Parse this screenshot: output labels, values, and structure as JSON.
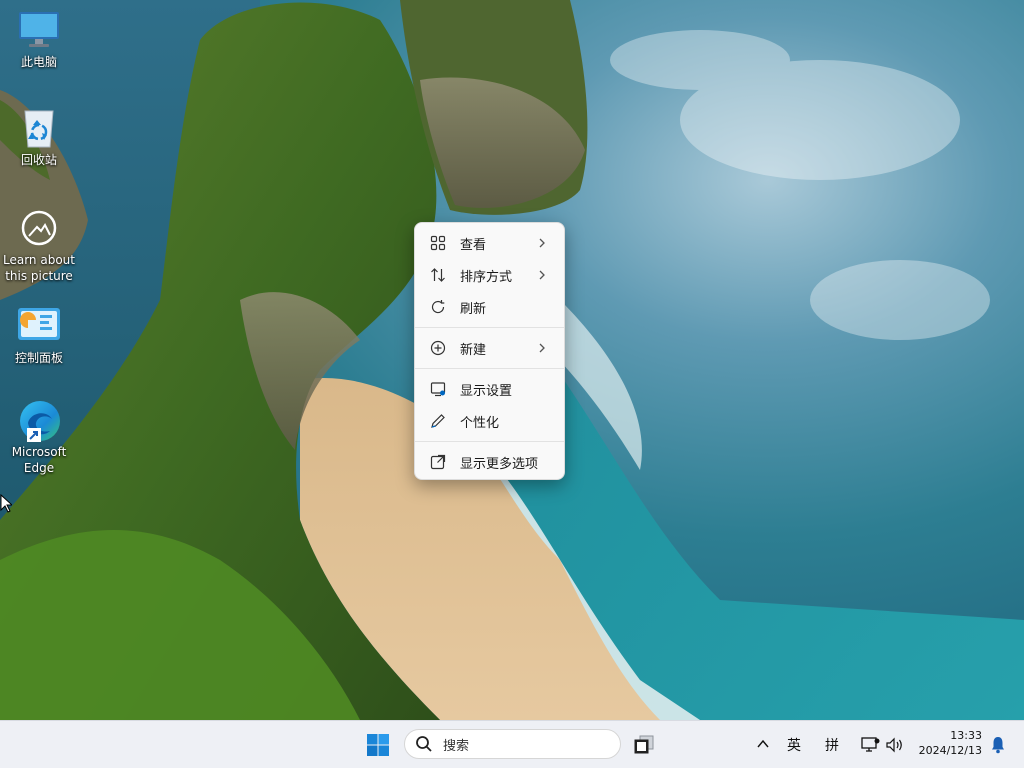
{
  "desktop": {
    "icons": [
      {
        "label": "此电脑",
        "icon": "computer-icon"
      },
      {
        "label": "回收站",
        "icon": "recycle-bin-icon"
      },
      {
        "label": "Learn about this picture",
        "icon": "camera-info-icon"
      },
      {
        "label": "控制面板",
        "icon": "control-panel-icon"
      },
      {
        "label": "Microsoft Edge",
        "icon": "edge-icon"
      }
    ]
  },
  "context_menu": {
    "items": [
      {
        "label": "查看",
        "icon": "grid-icon",
        "has_submenu": true
      },
      {
        "label": "排序方式",
        "icon": "sort-icon",
        "has_submenu": true
      },
      {
        "label": "刷新",
        "icon": "refresh-icon",
        "has_submenu": false
      },
      {
        "label": "新建",
        "icon": "plus-circle-icon",
        "has_submenu": true
      },
      {
        "label": "显示设置",
        "icon": "display-settings-icon",
        "has_submenu": false
      },
      {
        "label": "个性化",
        "icon": "pen-icon",
        "has_submenu": false
      },
      {
        "label": "显示更多选项",
        "icon": "open-external-icon",
        "has_submenu": false
      }
    ]
  },
  "taskbar": {
    "search_placeholder": "搜索",
    "tray": {
      "ime_lang": "英",
      "ime_mode": "拼",
      "time": "13:33",
      "date": "2024/12/13"
    }
  },
  "colors": {
    "taskbar_bg": "#eef0f5",
    "menu_bg": "#f9f9f9",
    "accent": "#0067c0"
  }
}
